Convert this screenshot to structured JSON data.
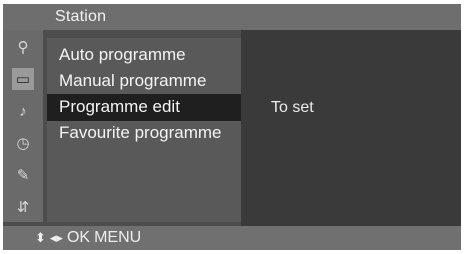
{
  "title": "Station",
  "sidebar": {
    "icons": [
      {
        "name": "antenna-icon",
        "glyph": "⚲"
      },
      {
        "name": "picture-icon",
        "glyph": "▭"
      },
      {
        "name": "audio-icon",
        "glyph": "♪"
      },
      {
        "name": "clock-icon",
        "glyph": "◷"
      },
      {
        "name": "tool-icon",
        "glyph": "✎"
      },
      {
        "name": "input-icon",
        "glyph": "⇵"
      }
    ]
  },
  "menu": {
    "items": [
      {
        "label": "Auto programme"
      },
      {
        "label": "Manual programme"
      },
      {
        "label": "Programme edit"
      },
      {
        "label": "Favourite programme"
      }
    ],
    "selected_index": 2
  },
  "panel": {
    "text": "To set"
  },
  "footer": {
    "updown": "⬍",
    "leftright": "◂▸",
    "ok": "OK",
    "menu": "MENU"
  }
}
